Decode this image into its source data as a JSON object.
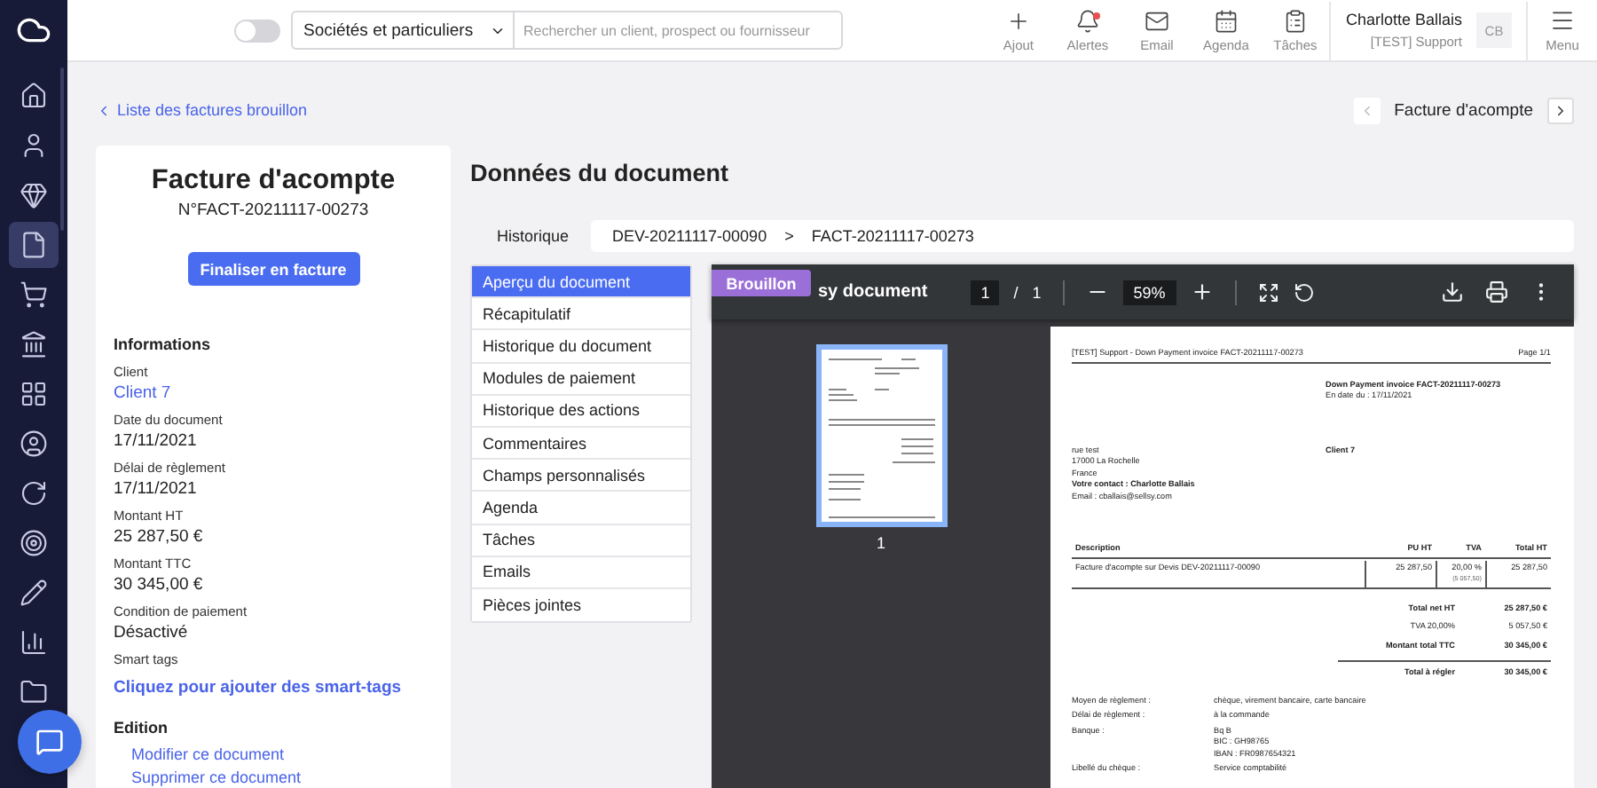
{
  "sidebar": {
    "items": [
      {
        "selected": false
      },
      {
        "selected": false
      },
      {
        "selected": false
      },
      {
        "selected": true
      },
      {
        "selected": false
      },
      {
        "selected": false
      },
      {
        "selected": false
      },
      {
        "selected": false
      },
      {
        "selected": false
      },
      {
        "selected": false
      },
      {
        "selected": false
      },
      {
        "selected": false
      },
      {
        "selected": false
      }
    ]
  },
  "topbar": {
    "toggle": {
      "on": false
    },
    "filter": {
      "value": "Sociétés et particuliers"
    },
    "search": {
      "placeholder": "Rechercher un client, prospect ou fournisseur"
    },
    "actions": [
      {
        "label": "Ajout",
        "badge": false
      },
      {
        "label": "Alertes",
        "badge": true
      },
      {
        "label": "Email",
        "badge": false
      },
      {
        "label": "Agenda",
        "badge": false
      },
      {
        "label": "Tâches",
        "badge": false
      }
    ],
    "user": {
      "name": "Charlotte Ballais",
      "role": "[TEST] Support",
      "initials": "CB"
    },
    "menu": {
      "label": "Menu"
    }
  },
  "back_link": "Liste des factures brouillon",
  "pager": {
    "title": "Facture d'acompte",
    "prev": {
      "disabled": true
    },
    "next": {
      "disabled": false
    }
  },
  "summary": {
    "title": "Facture d'acompte",
    "number": "N°FACT-20211117-00273",
    "action": "Finaliser en facture",
    "section": "Informations",
    "fields": [
      {
        "label": "Client",
        "value": "Client 7",
        "kind": "link"
      },
      {
        "label": "Date du document",
        "value": "17/11/2021",
        "kind": "text"
      },
      {
        "label": "Délai de règlement",
        "value": "17/11/2021",
        "kind": "text"
      },
      {
        "label": "Montant HT",
        "value": "25 287,50 €",
        "kind": "text"
      },
      {
        "label": "Montant TTC",
        "value": "30 345,00 €",
        "kind": "text"
      },
      {
        "label": "Condition de paiement",
        "value": "Désactivé",
        "kind": "text"
      },
      {
        "label": "Smart tags",
        "value": "Cliquez pour ajouter des smart-tags",
        "kind": "action"
      }
    ],
    "edition": {
      "title": "Edition",
      "links": [
        "Modifier ce document",
        "Supprimer ce document"
      ]
    }
  },
  "document": {
    "title": "Données du document",
    "history": {
      "label": "Historique",
      "steps": [
        "DEV-20211117-00090",
        "FACT-20211117-00273"
      ],
      "separator": ">"
    }
  },
  "nav": [
    {
      "label": "Aperçu du document",
      "selected": true
    },
    {
      "label": "Récapitulatif",
      "selected": false
    },
    {
      "label": "Historique du document",
      "selected": false
    },
    {
      "label": "Modules de paiement",
      "selected": false
    },
    {
      "label": "Historique des actions",
      "selected": false
    },
    {
      "label": "Commentaires",
      "selected": false
    },
    {
      "label": "Champs personnalisés",
      "selected": false
    },
    {
      "label": "Agenda",
      "selected": false
    },
    {
      "label": "Tâches",
      "selected": false
    },
    {
      "label": "Emails",
      "selected": false
    },
    {
      "label": "Pièces jointes",
      "selected": false
    }
  ],
  "viewer": {
    "status": "Brouillon",
    "title": "sy document",
    "page": "1",
    "of": "/",
    "pages": "1",
    "zoom": "59%",
    "thumbnails": [
      {
        "label": "1",
        "selected": true
      }
    ]
  },
  "pdf": {
    "header": "[TEST] Support - Down Payment invoice FACT-20211117-00273",
    "page_no": "Page 1/1",
    "doc_title": "Down Payment invoice FACT-20211117-00273",
    "doc_date": "En date du : 17/11/2021",
    "client": "Client 7",
    "address": [
      "rue test",
      "17000 La Rochelle",
      "France"
    ],
    "contact": "Votre contact : Charlotte Ballais",
    "email": "Email : cballais@sellsy.com",
    "columns": [
      "Description",
      "PU HT",
      "TVA",
      "Total HT"
    ],
    "rows": [
      {
        "description": "Facture d'acompte sur Devis DEV-20211117-00090",
        "unit": "25 287,50",
        "vat": "20,00 %",
        "vat_amount": "(5 057,50)",
        "total": "25 287,50"
      }
    ],
    "totals": [
      {
        "label": "Total net HT",
        "value": "25 287,50 €",
        "bold": true
      },
      {
        "label": "TVA 20,00%",
        "value": "5 057,50 €",
        "bold": false
      },
      {
        "label": "Montant total TTC",
        "value": "30 345,00 €",
        "bold": true
      }
    ],
    "due": {
      "label": "Total à régler",
      "value": "30 345,00 €"
    },
    "payment": [
      {
        "label": "Moyen de règlement :",
        "lines": [
          "chèque, virement bancaire, carte bancaire"
        ]
      },
      {
        "label": "Délai de règlement :",
        "lines": [
          "à la commande"
        ]
      },
      {
        "label": "Banque :",
        "lines": [
          "Bq B",
          "BIC : GH98765",
          "IBAN : FR0987654321"
        ]
      },
      {
        "label": "Libellé du chèque :",
        "lines": [
          "Service comptabilité"
        ]
      }
    ]
  }
}
